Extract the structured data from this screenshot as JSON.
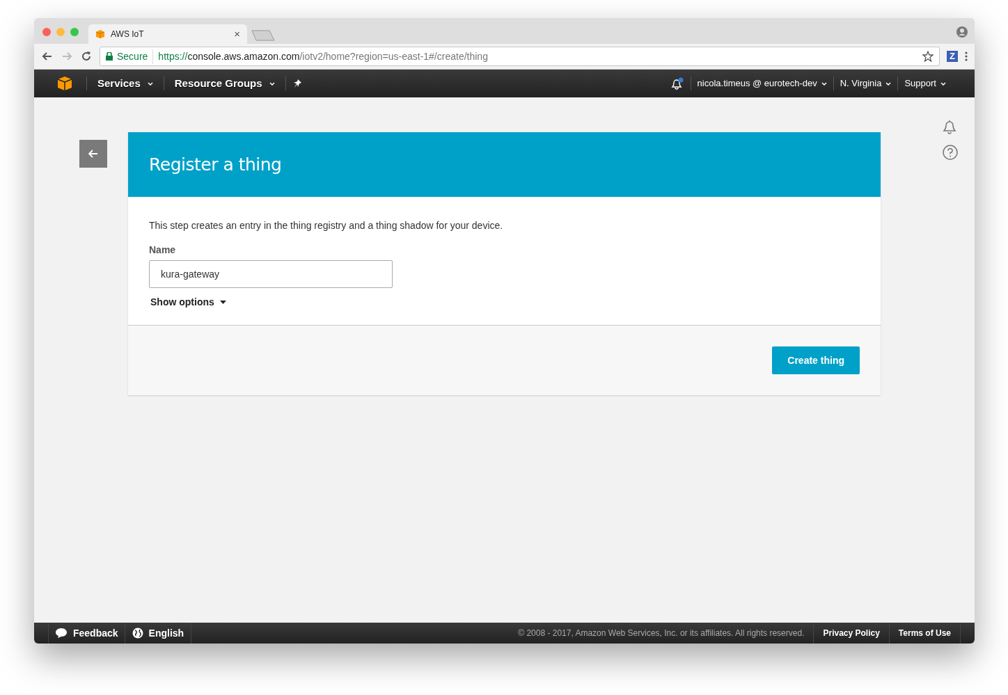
{
  "browser": {
    "tab_title": "AWS IoT",
    "tab_close": "×",
    "secure_label": "Secure",
    "url": {
      "scheme": "https://",
      "host": "console.aws.amazon.com",
      "path": "/iotv2/home?region=us-east-1#/create/thing"
    },
    "extension_letter": "Z"
  },
  "nav": {
    "left": [
      {
        "label": "Services"
      },
      {
        "label": "Resource Groups"
      }
    ],
    "notification_dot": true,
    "right": [
      {
        "label": "nicola.timeus @ eurotech-dev"
      },
      {
        "label": "N. Virginia"
      },
      {
        "label": "Support"
      }
    ]
  },
  "panel": {
    "title": "Register a thing",
    "description": "This step creates an entry in the thing registry and a thing shadow for your device.",
    "name_label": "Name",
    "name_value": "kura-gateway",
    "show_options": "Show options",
    "create_button": "Create thing"
  },
  "footer": {
    "feedback": "Feedback",
    "language": "English",
    "copyright": "© 2008 - 2017, Amazon Web Services, Inc. or its affiliates. All rights reserved.",
    "links": [
      "Privacy Policy",
      "Terms of Use"
    ]
  }
}
